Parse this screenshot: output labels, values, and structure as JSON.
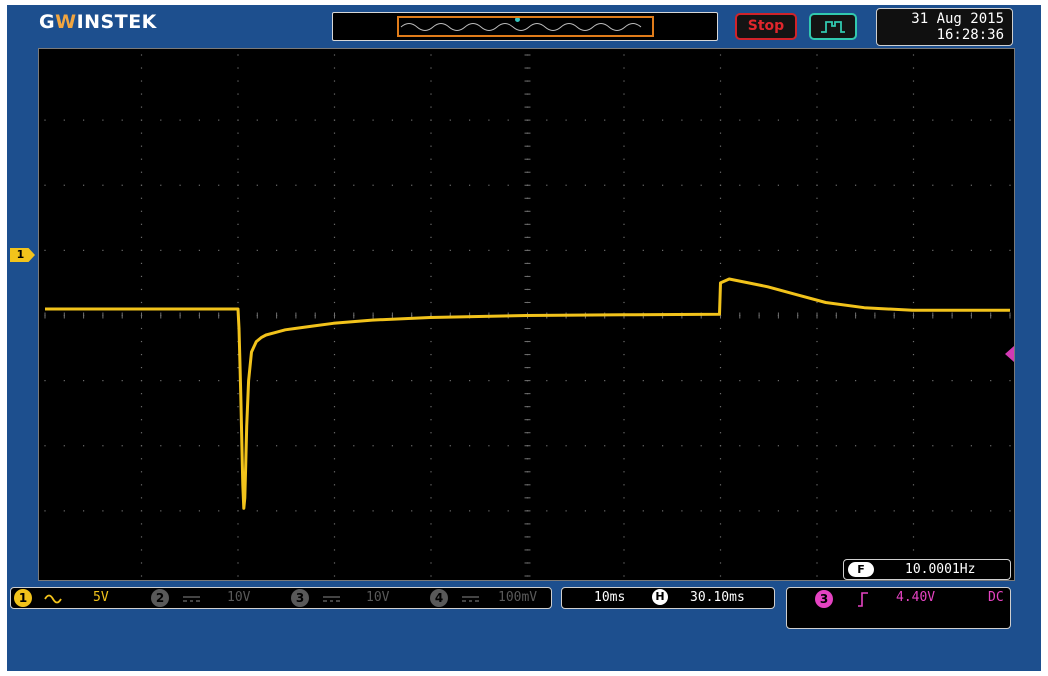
{
  "header": {
    "brand": {
      "part1": "G",
      "part2": "W",
      "part3": "INSTEK"
    },
    "run_status": "Stop",
    "trigger_icon": "pulse-trigger-icon",
    "date": "31 Aug 2015",
    "time": "16:28:36"
  },
  "display": {
    "channel_marker": "1",
    "frequency_label": "F",
    "frequency": "10.0001Hz"
  },
  "channels": [
    {
      "number": "1",
      "coupling_icon": "ac-coupling-icon",
      "scale": "5V",
      "active": true,
      "color": "#f2c31b"
    },
    {
      "number": "2",
      "coupling_icon": "dc-coupling-icon",
      "scale": "10V",
      "active": false,
      "color": "#5a5a5a"
    },
    {
      "number": "3",
      "coupling_icon": "dc-coupling-icon",
      "scale": "10V",
      "active": false,
      "color": "#5a5a5a"
    },
    {
      "number": "4",
      "coupling_icon": "dc-coupling-icon",
      "scale": "100mV",
      "active": false,
      "color": "#5a5a5a"
    }
  ],
  "timebase": {
    "scale": "10ms",
    "position_label": "H",
    "position": "30.10ms"
  },
  "trigger": {
    "source": "3",
    "slope_icon": "rising-edge-icon",
    "level": "4.40V",
    "coupling": "DC"
  },
  "colors": {
    "ch1": "#f2c31b",
    "trigger": "#e543c2",
    "stop": "#d1232a",
    "background": "#1d4f8e",
    "grid_dots": "#6f6f6f"
  },
  "chart_data": {
    "type": "line",
    "title": "",
    "xlabel": "",
    "ylabel": "",
    "xlim": [
      -19.9,
      80.1
    ],
    "ylim": [
      -20,
      20
    ],
    "x": [
      -19.9,
      0.1,
      0.2,
      0.3,
      0.4,
      0.5,
      0.6,
      0.7,
      0.8,
      0.9,
      1.0,
      1.2,
      1.5,
      2.0,
      2.5,
      3.0,
      4.0,
      5.0,
      6.0,
      8.0,
      10.0,
      14.0,
      20.0,
      30.0,
      40.0,
      50.0,
      50.1,
      51.0,
      53.0,
      55.0,
      58.0,
      61.0,
      65.0,
      70.0,
      75.0,
      80.1
    ],
    "y": [
      0.5,
      0.5,
      -1.0,
      -3.5,
      -6.5,
      -10.0,
      -13.0,
      -14.8,
      -14.0,
      -11.5,
      -8.5,
      -5.0,
      -2.8,
      -2.0,
      -1.7,
      -1.5,
      -1.3,
      -1.1,
      -1.0,
      -0.8,
      -0.6,
      -0.35,
      -0.15,
      0.0,
      0.05,
      0.1,
      2.5,
      2.8,
      2.5,
      2.2,
      1.6,
      1.0,
      0.6,
      0.4,
      0.4,
      0.4
    ],
    "divisions": {
      "x": 10,
      "y": 8
    },
    "units_per_div": {
      "x": "10ms",
      "y": "5V"
    },
    "series": [
      {
        "values": "y"
      }
    ]
  }
}
